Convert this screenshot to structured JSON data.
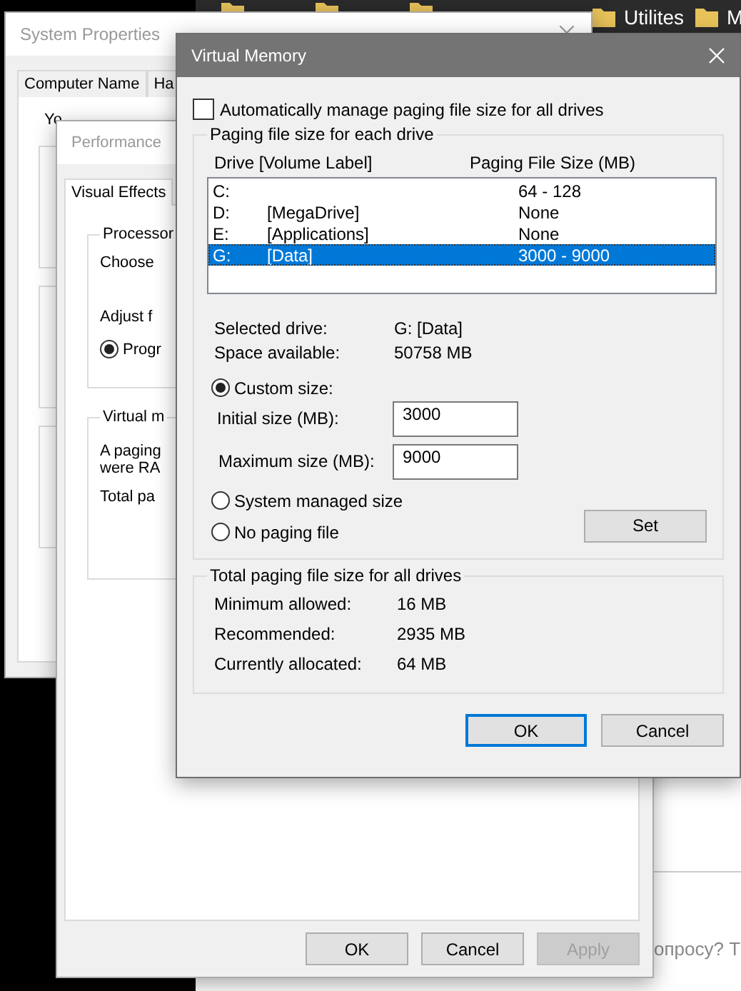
{
  "desktop_bar": {
    "folders": [
      {
        "label": "Utilites"
      },
      {
        "label": "M"
      }
    ]
  },
  "web_page": {
    "text": "опросу? Т"
  },
  "system_properties": {
    "title": "System Properties",
    "tabs": [
      {
        "label": "Computer Name",
        "selected": false
      },
      {
        "label": "Ha",
        "selected": false
      }
    ],
    "intro": "Yo"
  },
  "performance_options": {
    "title": "Performance",
    "tabs": [
      {
        "label": "Visual Effects",
        "selected": true
      }
    ],
    "processor_group": {
      "title": "Processor",
      "lines": [
        "Choose",
        "Adjust f"
      ],
      "radio": {
        "label": "Progr",
        "selected": true
      }
    },
    "virtual_memory_group": {
      "title": "Virtual m",
      "lines": [
        "A paging",
        "were RA"
      ],
      "total": "Total pa"
    },
    "buttons": [
      {
        "label": "OK",
        "disabled": false
      },
      {
        "label": "Cancel",
        "disabled": false
      },
      {
        "label": "Apply",
        "disabled": true
      }
    ]
  },
  "virtual_memory": {
    "title": "Virtual Memory",
    "auto_manage": {
      "label": "Automatically manage paging file size for all drives",
      "checked": false
    },
    "drive_group": {
      "title": "Paging file size for each drive",
      "columns": [
        "Drive  [Volume Label]",
        "Paging File Size (MB)"
      ],
      "drives": [
        {
          "drive": "C:",
          "size": "64 - 128",
          "selected": false
        },
        {
          "drive": "D:",
          "label": "[MegaDrive]",
          "size": "None",
          "selected": false
        },
        {
          "drive": "E:",
          "label": "[Applications]",
          "size": "None",
          "selected": false
        },
        {
          "drive": "G:",
          "label": "[Data]",
          "size": "3000 - 9000",
          "selected": true
        }
      ],
      "info": [
        {
          "label": "Selected drive:",
          "value": "G:  [Data]"
        },
        {
          "label": "Space available:",
          "value": "50758 MB"
        }
      ],
      "custom_size": {
        "label": "Custom size:",
        "selected": true
      },
      "initial_size": {
        "label": "Initial size (MB):",
        "value": "3000"
      },
      "maximum_size": {
        "label": "Maximum size (MB):",
        "value": "9000"
      },
      "system_managed": {
        "label": "System managed size",
        "selected": false
      },
      "no_paging": {
        "label": "No paging file",
        "selected": false
      },
      "set_button": "Set"
    },
    "total_group": {
      "title": "Total paging file size for all drives",
      "rows": [
        {
          "label": "Minimum allowed:",
          "value": "16 MB"
        },
        {
          "label": "Recommended:",
          "value": "2935 MB"
        },
        {
          "label": "Currently allocated:",
          "value": "64 MB"
        }
      ]
    },
    "buttons": [
      {
        "label": "OK",
        "focused": true
      },
      {
        "label": "Cancel",
        "focused": false
      }
    ]
  }
}
